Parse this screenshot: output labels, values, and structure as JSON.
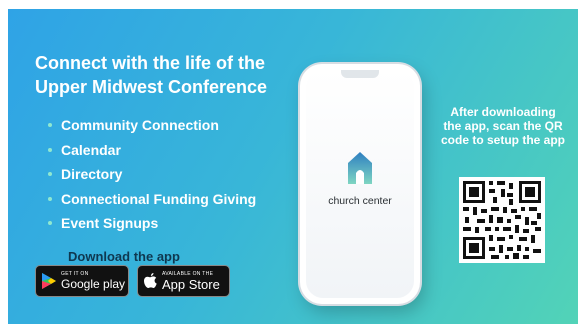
{
  "headline": "Connect with the life of the Upper Midwest Conference",
  "features": [
    "Community Connection",
    "Calendar",
    "Directory",
    "Connectional Funding Giving",
    "Event Signups"
  ],
  "download_label": "Download the app",
  "badges": {
    "google_play": {
      "small": "GET IT ON",
      "big": "Google play"
    },
    "app_store": {
      "small": "AVAILABLE ON THE",
      "big": "App Store"
    }
  },
  "app_name": "church center",
  "qr_caption": "After downloading the app, scan the QR code to setup the app",
  "colors": {
    "gradient_start": "#2fa3e6",
    "gradient_end": "#52d3b7",
    "logo_top": "#2e7fc1",
    "logo_bottom": "#7fd6c2"
  }
}
